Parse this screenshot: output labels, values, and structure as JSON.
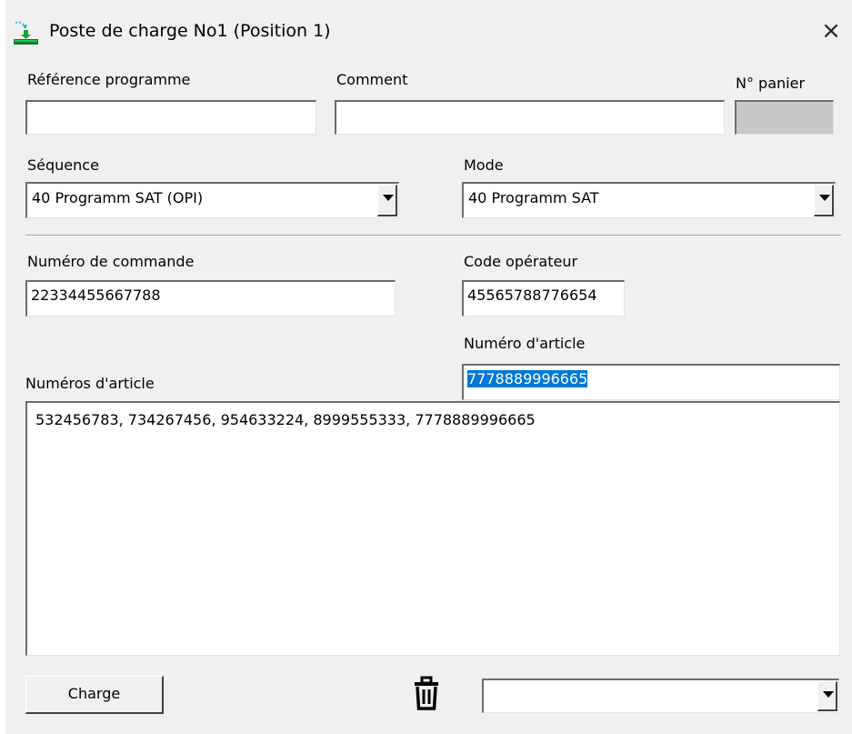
{
  "window": {
    "title": "Poste de charge No1 (Position 1)",
    "close_label": "×"
  },
  "fields": {
    "reference_programme": {
      "label": "Référence programme",
      "value": ""
    },
    "comment": {
      "label": "Comment",
      "value": ""
    },
    "panier": {
      "label": "N° panier",
      "value": ""
    },
    "sequence": {
      "label": "Séquence",
      "value": "40 Programm SAT  (OPI)"
    },
    "mode": {
      "label": "Mode",
      "value": "40 Programm SAT"
    },
    "numero_commande": {
      "label": "Numéro de commande",
      "value": "22334455667788"
    },
    "code_operateur": {
      "label": "Code opérateur",
      "value": "45565788776654"
    },
    "numero_article": {
      "label": "Numéro d'article",
      "value": "7778889996665"
    },
    "numeros_article": {
      "label": "Numéros d'article",
      "value": "532456783, 734267456, 954633224, 8999555333, 7778889996665"
    }
  },
  "footer": {
    "charge_label": "Charge",
    "bottom_select_value": ""
  },
  "icons": {
    "app": "loading-station-icon",
    "delete": "trash-icon",
    "dropdown": "chevron-down-icon",
    "close": "close-icon"
  },
  "colors": {
    "selection": "#0078d7",
    "window_bg": "#f0f0f0",
    "disabled_field": "#c8c8c8"
  }
}
